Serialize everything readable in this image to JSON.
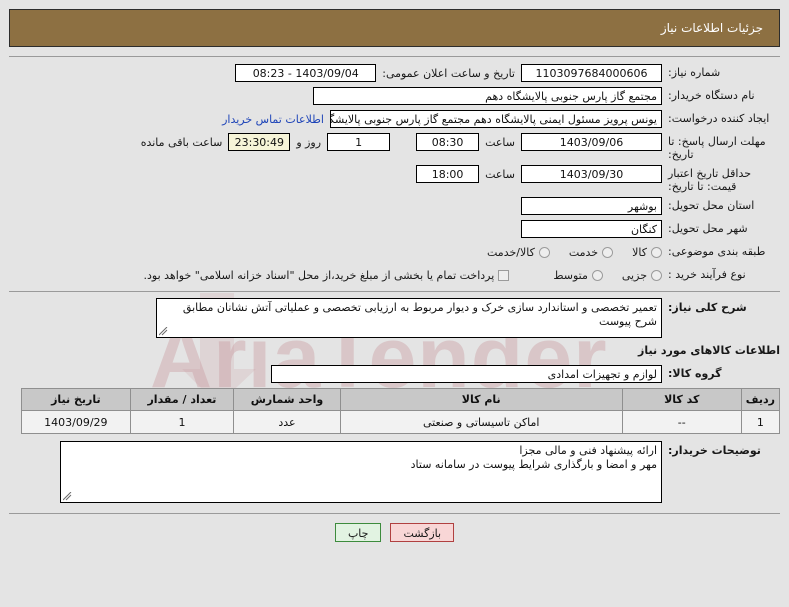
{
  "header": {
    "title": "جزئیات اطلاعات نیاز"
  },
  "colors": {
    "header_bg": "#8d7042",
    "page_bg": "#e4e4e4",
    "link": "#1e44b8",
    "countdown_bg": "#f6f4d8",
    "back_button_bg": "#f8d6d6",
    "print_button_bg": "#e2f3e2"
  },
  "form": {
    "need_number_label": "شماره نیاز:",
    "need_number_value": "1103097684000606",
    "public_announce_label": "تاریخ و ساعت اعلان عمومی:",
    "public_announce_value": "1403/09/04 - 08:23",
    "buyer_org_label": "نام دستگاه خریدار:",
    "buyer_org_value": "مجتمع گاز پارس جنوبی  پالایشگاه دهم",
    "creator_label": "ایجاد کننده درخواست:",
    "creator_value": "یونس پرویز مسئول ایمنی پالایشگاه دهم  مجتمع گاز پارس جنوبی  پالایشگاه دهم",
    "contact_link": "اطلاعات تماس خریدار",
    "answer_deadline_label": "مهلت ارسال پاسخ: تا تاریخ:",
    "answer_deadline_date": "1403/09/06",
    "hour_label": "ساعت",
    "answer_deadline_time": "08:30",
    "remaining_days": "1",
    "days_and_label": "روز و",
    "remaining_time": "23:30:49",
    "remaining_suffix": "ساعت باقی مانده",
    "price_validity_label": "حداقل تاریخ اعتبار قیمت: تا تاریخ:",
    "price_validity_date": "1403/09/30",
    "price_validity_time": "18:00",
    "province_label": "استان محل تحویل:",
    "province_value": "بوشهر",
    "city_label": "شهر محل تحویل:",
    "city_value": "کنگان",
    "classification_label": "طبقه بندی موضوعی:",
    "classification_options": [
      "کالا",
      "خدمت",
      "کالا/خدمت"
    ],
    "process_type_label": "نوع فرآیند خرید :",
    "process_type_options": [
      "جزیی",
      "متوسط"
    ],
    "treasury_checkbox_text": "پرداخت تمام یا بخشی از مبلغ خرید،از محل \"اسناد خزانه اسلامی\" خواهد بود."
  },
  "need_description": {
    "label": "شرح کلی نیاز:",
    "value": "تعمیر تخصصی و استاندارد سازی خرک و دیوار مربوط به ارزیابی تخصصی و عملیاتی آتش نشانان مطابق شرح پیوست"
  },
  "goods_section": {
    "heading": "اطلاعات کالاهای مورد نیاز",
    "group_label": "گروه کالا:",
    "group_value": "لوازم و تجهیزات امدادی",
    "columns": [
      "ردیف",
      "کد کالا",
      "نام کالا",
      "واحد شمارش",
      "تعداد / مقدار",
      "تاریخ نیاز"
    ],
    "rows": [
      {
        "row_no": "1",
        "code": "--",
        "name": "اماکن تاسیساتی و صنعتی",
        "unit": "عدد",
        "quantity": "1",
        "need_date": "1403/09/29"
      }
    ]
  },
  "buyer_notes": {
    "label": "توضیحات خریدار:",
    "line1": "ارائه پیشنهاد فنی و مالی مجزا",
    "line2": "مهر و امضا و بارگذاری شرایط پیوست در سامانه ستاد"
  },
  "footer": {
    "back_button": "بازگشت",
    "print_button": "چاپ"
  },
  "watermark": {
    "text": "AriaTender"
  }
}
